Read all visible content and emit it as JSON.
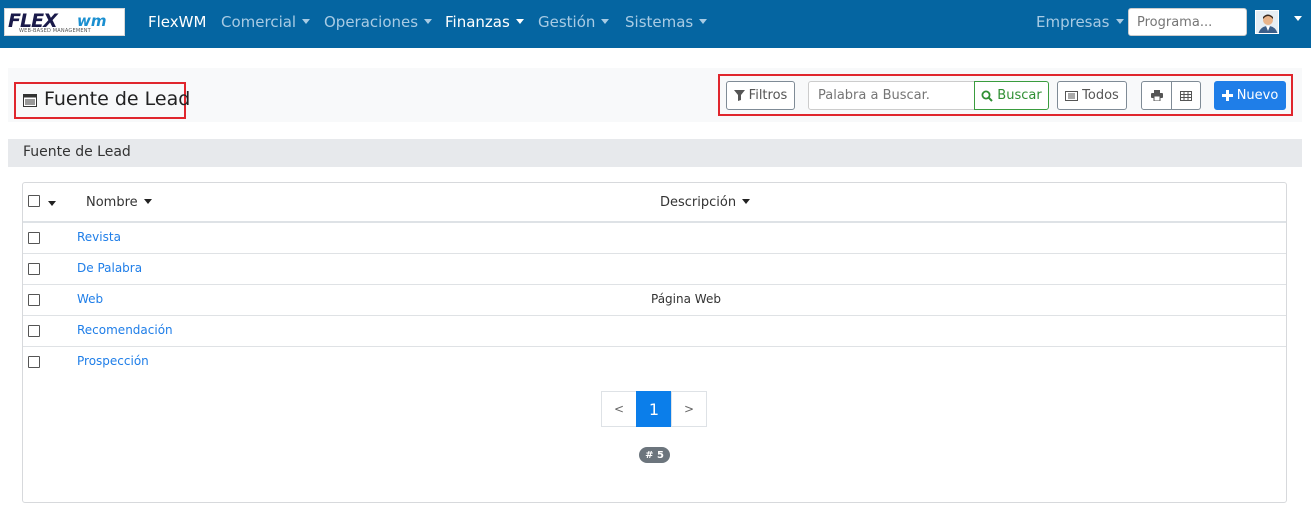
{
  "brand": {
    "logo_main": "FLEX",
    "logo_accent": "wm",
    "logo_sub": "WEB-BASED MANAGEMENT",
    "app_name": "FlexWM"
  },
  "nav": {
    "items": [
      {
        "label": "Comercial"
      },
      {
        "label": "Operaciones"
      },
      {
        "label": "Finanzas"
      },
      {
        "label": "Gestión"
      },
      {
        "label": "Sistemas"
      }
    ],
    "companies_label": "Empresas",
    "program_placeholder": "Programa..."
  },
  "page": {
    "title": "Fuente de Lead",
    "section_title": "Fuente de Lead"
  },
  "toolbar": {
    "filters_label": "Filtros",
    "search_placeholder": "Palabra a Buscar.",
    "search_label": "Buscar",
    "all_label": "Todos",
    "new_label": "Nuevo"
  },
  "table": {
    "columns": [
      "Nombre",
      "Descripción"
    ],
    "rows": [
      {
        "name": "Revista",
        "description": ""
      },
      {
        "name": "De Palabra",
        "description": ""
      },
      {
        "name": "Web",
        "description": "Página Web"
      },
      {
        "name": "Recomendación",
        "description": ""
      },
      {
        "name": "Prospección",
        "description": ""
      }
    ]
  },
  "pagination": {
    "prev": "<",
    "current": "1",
    "next": ">",
    "count_badge": "# 5"
  },
  "colors": {
    "navbar": "#0565a1",
    "primary": "#1f7ee8",
    "success": "#3a9c3e",
    "highlight": "#e0262d"
  },
  "icons": [
    "filter-icon",
    "search-icon",
    "list-icon",
    "print-icon",
    "table-icon",
    "plus-icon",
    "user-avatar",
    "grid-icon"
  ]
}
